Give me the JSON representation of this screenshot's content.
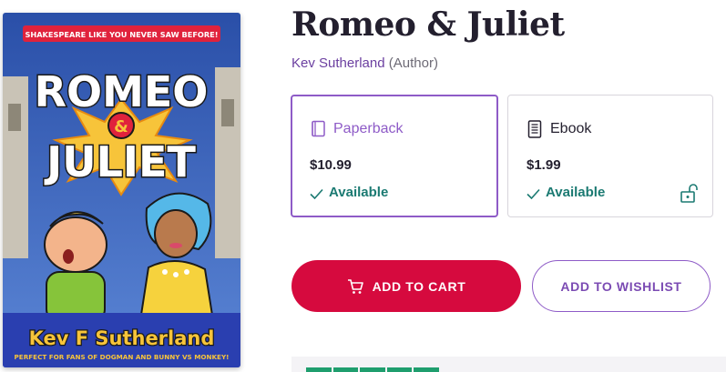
{
  "cover": {
    "tagline": "SHAKESPEARE LIKE YOU NEVER SAW BEFORE!",
    "title_line1": "ROMEO",
    "ampersand": "&",
    "title_line2": "JULIET",
    "author": "Kev F Sutherland",
    "blurb": "PERFECT FOR FANS OF DOGMAN AND BUNNY VS MONKEY!"
  },
  "product": {
    "title": "Romeo & Juliet",
    "author_name": "Kev Sutherland",
    "author_role": "(Author)"
  },
  "formats": [
    {
      "label": "Paperback",
      "price": "$10.99",
      "availability": "Available",
      "icon": "book-icon",
      "selected": true
    },
    {
      "label": "Ebook",
      "price": "$1.99",
      "availability": "Available",
      "icon": "ebook-reader-icon",
      "selected": false,
      "badge_icon": "unlock-icon"
    }
  ],
  "actions": {
    "add_to_cart": "ADD TO CART",
    "add_to_wishlist": "ADD TO WISHLIST"
  },
  "colors": {
    "accent_purple": "#8e5bc7",
    "cart_red": "#d60a3e",
    "available_teal": "#1b7a72"
  }
}
